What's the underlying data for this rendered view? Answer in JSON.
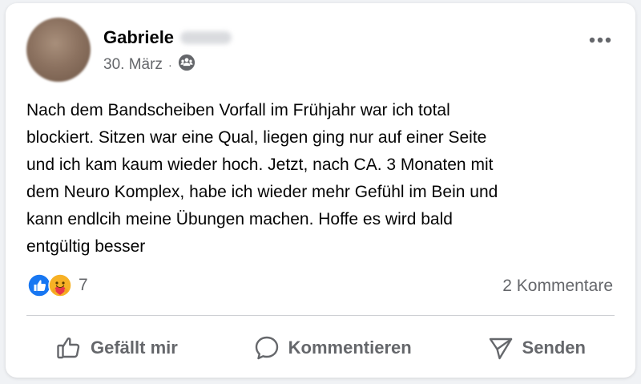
{
  "post": {
    "author_first_name": "Gabriele",
    "date": "30. März",
    "meta_separator": "·",
    "audience_icon": "friends-icon",
    "text": "Nach dem Bandscheiben Vorfall im Frühjahr war ich total\nblockiert. Sitzen war eine Qual, liegen ging nur auf einer Seite\nund ich kam kaum wieder hoch. Jetzt, nach CA. 3 Monaten mit\ndem Neuro Komplex, habe ich wieder mehr Gefühl im Bein und\nkann endlcih meine Übungen machen. Hoffe es wird bald\nentgültig besser"
  },
  "reactions": {
    "icons": [
      "like-icon",
      "care-icon"
    ],
    "count": "7",
    "comments": "2 Kommentare"
  },
  "actions": {
    "like": "Gefällt mir",
    "comment": "Kommentieren",
    "share": "Senden"
  },
  "colors": {
    "like_blue": "#1877f2",
    "secondary_text": "#65676b",
    "primary_text": "#050505"
  }
}
